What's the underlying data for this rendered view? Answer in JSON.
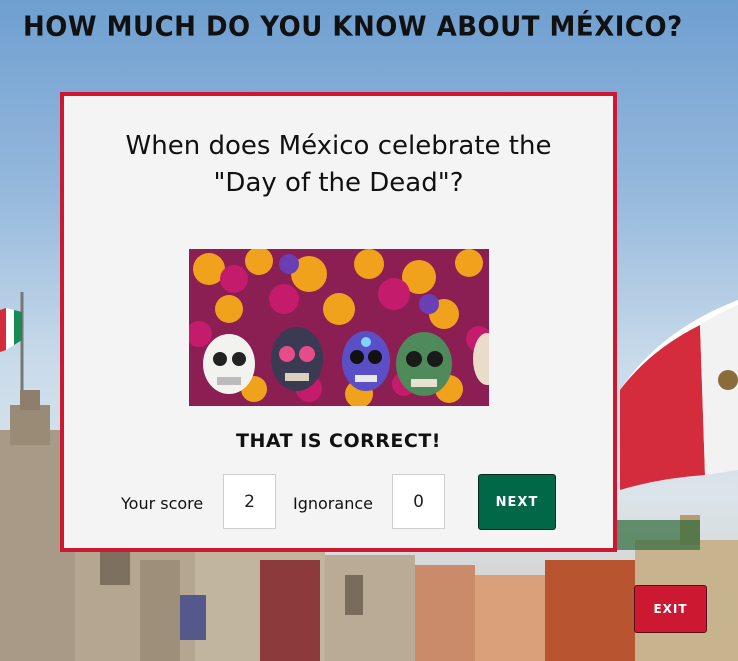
{
  "header": {
    "title": "How much do you know about México?"
  },
  "quiz": {
    "question": "When does México celebrate the \"Day of the Dead\"?",
    "feedback": "That is correct!",
    "score_label": "Your score",
    "score_value": "2",
    "ignorance_label": "Ignorance",
    "ignorance_value": "0",
    "next_label": "Next"
  },
  "exit_label": "Exit",
  "colors": {
    "card_border": "#cc1931",
    "next_button": "#006847",
    "exit_button": "#cc1931"
  },
  "icons": {
    "question_image": "sugar-skulls-marigolds-image"
  }
}
